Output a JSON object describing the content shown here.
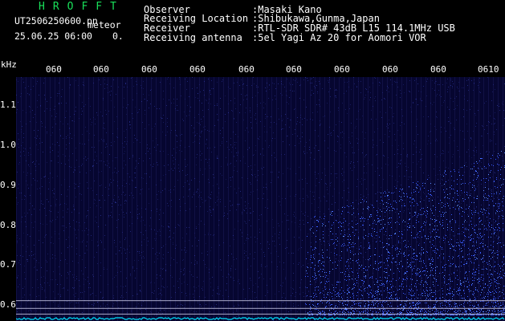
{
  "app": {
    "title": "HROFFT"
  },
  "file": {
    "name": "UT2506250600.pn",
    "label": "meteor",
    "timestamp": "25.06.25 06:00",
    "count": "0."
  },
  "info": [
    {
      "label": "Observer",
      "value": ":Masaki Kano"
    },
    {
      "label": "Receiving Location",
      "value": ":Shibukawa,Gunma,Japan"
    },
    {
      "label": "Receiver",
      "value": ":RTL-SDR SDR# 43dB L15 114.1MHz USB"
    },
    {
      "label": "Receiving antenna",
      "value": ":5el Yagi Az 20 for Aomori VOR"
    }
  ],
  "colors": {
    "background": "#000000",
    "plot_bg": "#060630",
    "signal": "#3a5cff",
    "title": "#19e05a",
    "baseline": "#00e5ff"
  },
  "chart_data": {
    "type": "heatmap",
    "ylabel": "kHz",
    "yticks": [
      "1.1",
      "1.0",
      "0.9",
      "0.8",
      "0.7",
      "0.6"
    ],
    "ytick_values": [
      1.1,
      1.0,
      0.9,
      0.8,
      0.7,
      0.6
    ],
    "ylim": [
      0.57,
      1.17
    ],
    "xticks": [
      "060",
      "060",
      "060",
      "060",
      "060",
      "060",
      "060",
      "060",
      "060",
      "0610"
    ],
    "reference_lines_khz": [
      0.621,
      0.602,
      0.588
    ],
    "grid": true
  }
}
